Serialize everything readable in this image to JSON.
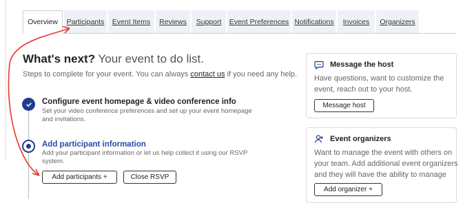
{
  "tabs": [
    {
      "label": "Overview",
      "active": true
    },
    {
      "label": "Participants"
    },
    {
      "label": "Event Items"
    },
    {
      "label": "Reviews"
    },
    {
      "label": "Support"
    },
    {
      "label": "Event Preferences"
    },
    {
      "label": "Notifications"
    },
    {
      "label": "Invoices"
    },
    {
      "label": "Organizers"
    }
  ],
  "main": {
    "heading_bold": "What's next?",
    "heading_rest": " Your event to do list.",
    "subtitle_before": "Steps to complete for your event. You can always ",
    "subtitle_link": "contact us",
    "subtitle_after": " if you need any help.",
    "steps": [
      {
        "title": "Configure event homepage & video conference info",
        "description": "Set your video conference preferences and set up your event homepage and invitations.",
        "status": "done"
      },
      {
        "title": "Add participant information",
        "description": "Add your participant information or let us help collect it using our RSVP system.",
        "status": "current",
        "buttons": [
          "Add participants  +",
          "Close RSVP"
        ]
      }
    ]
  },
  "cards": {
    "message_host": {
      "title": "Message the host",
      "text": "Have questions, want to customize the event, reach out to your host.",
      "button": "Message host",
      "icon": "chat-icon"
    },
    "organizers": {
      "title": "Event organizers",
      "text": "Want to manage the event with others on your team. Add additional event organizers and they will have the ability to manage events.",
      "button": "Add organizer  +",
      "icon": "add-user-icon"
    }
  },
  "colors": {
    "accent": "#1f3d8f",
    "current_step_title": "#2b4aa8",
    "tab_bg": "#eef2f7",
    "annotation_arrow": "#e8382a"
  }
}
